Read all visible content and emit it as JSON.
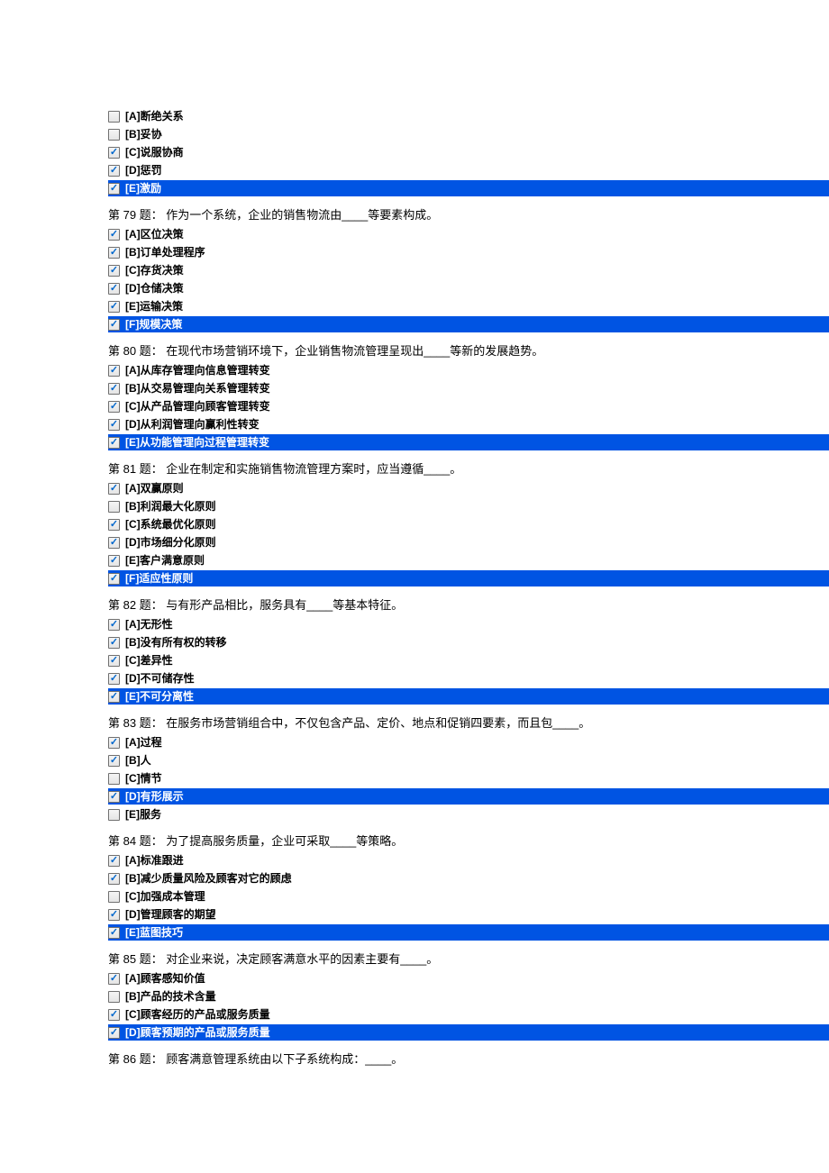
{
  "questions": [
    {
      "id": "q78",
      "text": "",
      "options": [
        {
          "label": "[A]断绝关系",
          "checked": false,
          "highlighted": false
        },
        {
          "label": "[B]妥协",
          "checked": false,
          "highlighted": false
        },
        {
          "label": "[C]说服协商",
          "checked": true,
          "highlighted": false
        },
        {
          "label": "[D]惩罚",
          "checked": true,
          "highlighted": false
        },
        {
          "label": "[E]激励",
          "checked": true,
          "highlighted": true
        }
      ]
    },
    {
      "id": "q79",
      "text": "第 79 题：  作为一个系统，企业的销售物流由____等要素构成。",
      "options": [
        {
          "label": "[A]区位决策",
          "checked": true,
          "highlighted": false
        },
        {
          "label": "[B]订单处理程序",
          "checked": true,
          "highlighted": false
        },
        {
          "label": "[C]存货决策",
          "checked": true,
          "highlighted": false
        },
        {
          "label": "[D]仓储决策",
          "checked": true,
          "highlighted": false
        },
        {
          "label": "[E]运输决策",
          "checked": true,
          "highlighted": false
        },
        {
          "label": "[F]规模决策",
          "checked": true,
          "highlighted": true
        }
      ]
    },
    {
      "id": "q80",
      "text": "第 80 题：  在现代市场营销环境下，企业销售物流管理呈现出____等新的发展趋势。",
      "options": [
        {
          "label": "[A]从库存管理向信息管理转变",
          "checked": true,
          "highlighted": false
        },
        {
          "label": "[B]从交易管理向关系管理转变",
          "checked": true,
          "highlighted": false
        },
        {
          "label": "[C]从产品管理向顾客管理转变",
          "checked": true,
          "highlighted": false
        },
        {
          "label": "[D]从利润管理向赢利性转变",
          "checked": true,
          "highlighted": false
        },
        {
          "label": "[E]从功能管理向过程管理转变",
          "checked": true,
          "highlighted": true
        }
      ]
    },
    {
      "id": "q81",
      "text": "第 81 题：  企业在制定和实施销售物流管理方案时，应当遵循____。",
      "options": [
        {
          "label": "[A]双赢原则",
          "checked": true,
          "highlighted": false
        },
        {
          "label": "[B]利润最大化原则",
          "checked": false,
          "highlighted": false
        },
        {
          "label": "[C]系统最优化原则",
          "checked": true,
          "highlighted": false
        },
        {
          "label": "[D]市场细分化原则",
          "checked": true,
          "highlighted": false
        },
        {
          "label": "[E]客户满意原则",
          "checked": true,
          "highlighted": false
        },
        {
          "label": "[F]适应性原则",
          "checked": true,
          "highlighted": true
        }
      ]
    },
    {
      "id": "q82",
      "text": "第 82 题：  与有形产品相比，服务具有____等基本特征。",
      "options": [
        {
          "label": "[A]无形性",
          "checked": true,
          "highlighted": false
        },
        {
          "label": "[B]没有所有权的转移",
          "checked": true,
          "highlighted": false
        },
        {
          "label": "[C]差异性",
          "checked": true,
          "highlighted": false
        },
        {
          "label": "[D]不可储存性",
          "checked": true,
          "highlighted": false
        },
        {
          "label": "[E]不可分离性",
          "checked": true,
          "highlighted": true
        }
      ]
    },
    {
      "id": "q83",
      "text": "第 83 题：  在服务市场营销组合中，不仅包含产品、定价、地点和促销四要素，而且包____。",
      "options": [
        {
          "label": "[A]过程",
          "checked": true,
          "highlighted": false
        },
        {
          "label": "[B]人",
          "checked": true,
          "highlighted": false
        },
        {
          "label": "[C]情节",
          "checked": false,
          "highlighted": false
        },
        {
          "label": "[D]有形展示",
          "checked": true,
          "highlighted": true
        },
        {
          "label": "[E]服务",
          "checked": false,
          "highlighted": false
        }
      ]
    },
    {
      "id": "q84",
      "text": "第 84 题：  为了提高服务质量，企业可采取____等策略。",
      "options": [
        {
          "label": "[A]标准跟进",
          "checked": true,
          "highlighted": false
        },
        {
          "label": "[B]减少质量风险及顾客对它的顾虑",
          "checked": true,
          "highlighted": false
        },
        {
          "label": "[C]加强成本管理",
          "checked": false,
          "highlighted": false
        },
        {
          "label": "[D]管理顾客的期望",
          "checked": true,
          "highlighted": false
        },
        {
          "label": "[E]蓝图技巧",
          "checked": true,
          "highlighted": true
        }
      ]
    },
    {
      "id": "q85",
      "text": "第 85 题：  对企业来说，决定顾客满意水平的因素主要有____。",
      "options": [
        {
          "label": "[A]顾客感知价值",
          "checked": true,
          "highlighted": false
        },
        {
          "label": "[B]产品的技术含量",
          "checked": false,
          "highlighted": false
        },
        {
          "label": "[C]顾客经历的产品或服务质量",
          "checked": true,
          "highlighted": false
        },
        {
          "label": "[D]顾客预期的产品或服务质量",
          "checked": true,
          "highlighted": true
        }
      ]
    },
    {
      "id": "q86",
      "text": "第 86 题：  顾客满意管理系统由以下子系统构成：____。",
      "options": []
    }
  ]
}
